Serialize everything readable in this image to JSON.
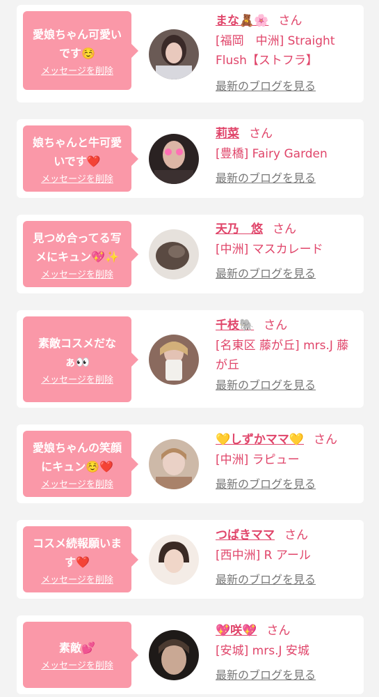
{
  "items": [
    {
      "message": "愛娘ちゃん可愛いです☺️",
      "delete_label": "メッセージを削除",
      "name": "まな🧸🌸",
      "honorific": "さん",
      "shop": "[福岡　中洲] Straight Flush【ストフラ】",
      "blog_link": "最新のブログを見る"
    },
    {
      "message": "娘ちゃんと牛可愛いです❤️",
      "delete_label": "メッセージを削除",
      "name": "莉菜",
      "honorific": "さん",
      "shop": "[豊橋] Fairy Garden",
      "blog_link": "最新のブログを見る"
    },
    {
      "message": "見つめ合ってる写メにキュン💖✨",
      "delete_label": "メッセージを削除",
      "name": "天乃　悠",
      "honorific": "さん",
      "shop": "[中洲] マスカレード",
      "blog_link": "最新のブログを見る"
    },
    {
      "message": "素敵コスメだなぁ👀",
      "delete_label": "メッセージを削除",
      "name": "千枝🐘",
      "honorific": "さん",
      "shop": "[名東区 藤が丘] mrs.J 藤が丘",
      "blog_link": "最新のブログを見る"
    },
    {
      "message": "愛娘ちゃんの笑顔にキュン☺️❤️",
      "delete_label": "メッセージを削除",
      "name": "💛しずかママ💛",
      "honorific": "さん",
      "shop": "[中洲] ラピュー",
      "blog_link": "最新のブログを見る"
    },
    {
      "message": "コスメ続報願います❤️",
      "delete_label": "メッセージを削除",
      "name": "つばきママ",
      "honorific": "さん",
      "shop": "[西中洲] R アール",
      "blog_link": "最新のブログを見る"
    },
    {
      "message": "素敵💕",
      "delete_label": "メッセージを削除",
      "name": "💖咲💖",
      "honorific": "さん",
      "shop": "[安城] mrs.J 安城",
      "blog_link": "最新のブログを見る"
    }
  ]
}
